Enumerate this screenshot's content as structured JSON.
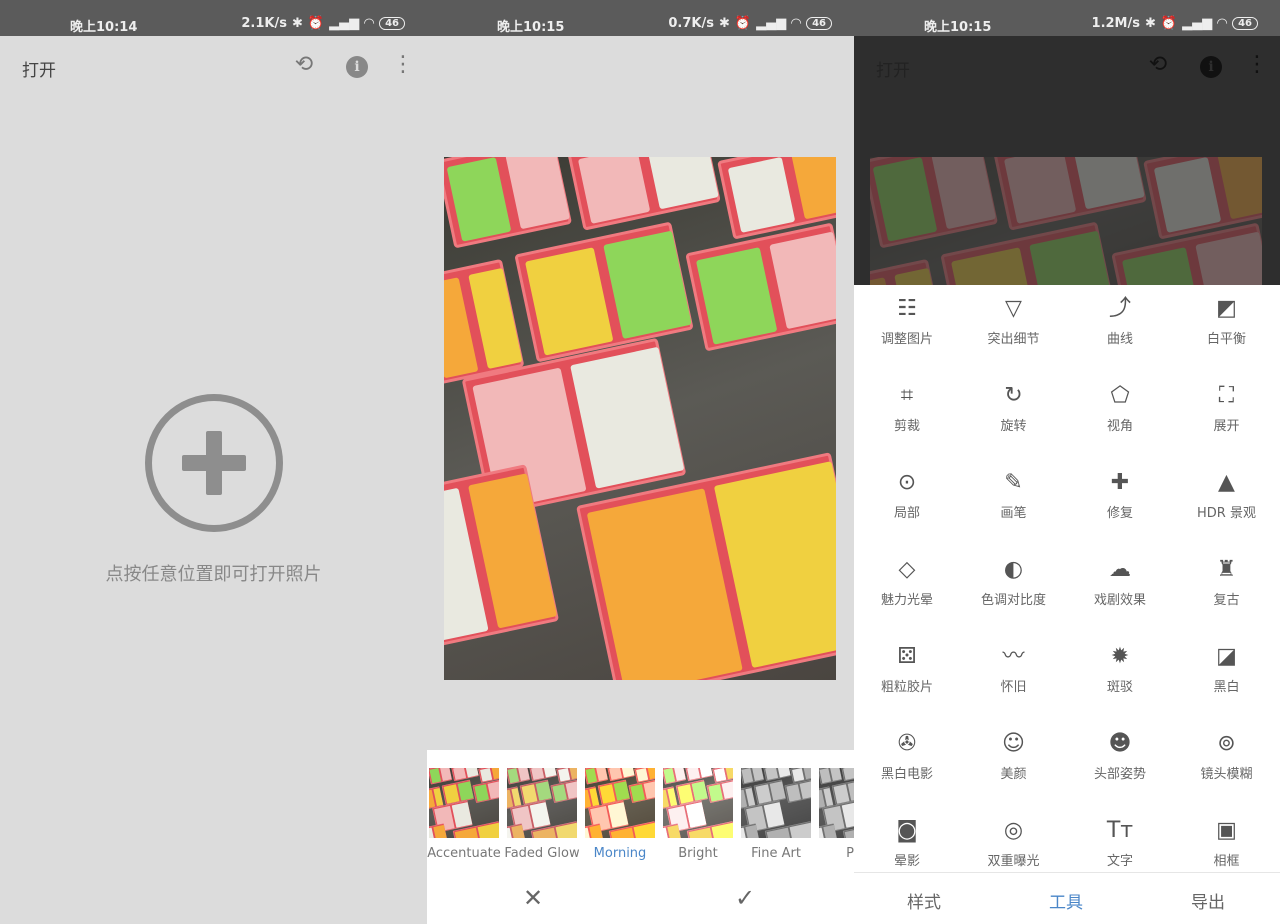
{
  "screens": [
    {
      "status": {
        "time": "晚上10:14",
        "speed": "2.1K/s",
        "battery": "46"
      },
      "appbar": {
        "title": "打开"
      },
      "hint": "点按任意位置即可打开照片"
    },
    {
      "status": {
        "time": "晚上10:15",
        "speed": "0.7K/s",
        "battery": "46"
      },
      "filters": [
        {
          "label": "Accentuate",
          "tint": "none"
        },
        {
          "label": "Faded Glow",
          "tint": "faded"
        },
        {
          "label": "Morning",
          "tint": "warm",
          "selected": true
        },
        {
          "label": "Bright",
          "tint": "bright"
        },
        {
          "label": "Fine Art",
          "tint": "bw"
        },
        {
          "label": "Pu",
          "tint": "bw"
        }
      ],
      "cancel": "✕",
      "apply": "✓"
    },
    {
      "status": {
        "time": "晚上10:15",
        "speed": "1.2M/s",
        "battery": "46"
      },
      "appbar": {
        "title": "打开"
      },
      "tools": [
        {
          "label": "调整图片",
          "icon": "tune-icon",
          "glyph": "☷"
        },
        {
          "label": "突出细节",
          "icon": "details-triangle-icon",
          "glyph": "▽"
        },
        {
          "label": "曲线",
          "icon": "curves-icon",
          "glyph": "⤴"
        },
        {
          "label": "白平衡",
          "icon": "white-balance-icon",
          "glyph": "◩"
        },
        {
          "label": "剪裁",
          "icon": "crop-icon",
          "glyph": "⌗"
        },
        {
          "label": "旋转",
          "icon": "rotate-icon",
          "glyph": "↻"
        },
        {
          "label": "视角",
          "icon": "perspective-icon",
          "glyph": "⬠"
        },
        {
          "label": "展开",
          "icon": "expand-icon",
          "glyph": "⛶"
        },
        {
          "label": "局部",
          "icon": "selective-icon",
          "glyph": "⊙"
        },
        {
          "label": "画笔",
          "icon": "brush-icon",
          "glyph": "✎"
        },
        {
          "label": "修复",
          "icon": "healing-icon",
          "glyph": "✚"
        },
        {
          "label": "HDR 景观",
          "icon": "hdr-mountain-icon",
          "glyph": "▲"
        },
        {
          "label": "魅力光晕",
          "icon": "glamour-glow-icon",
          "glyph": "◇"
        },
        {
          "label": "色调对比度",
          "icon": "tonal-contrast-icon",
          "glyph": "◐"
        },
        {
          "label": "戏剧效果",
          "icon": "drama-cloud-icon",
          "glyph": "☁"
        },
        {
          "label": "复古",
          "icon": "vintage-lamp-icon",
          "glyph": "♜"
        },
        {
          "label": "粗粒胶片",
          "icon": "grainy-film-icon",
          "glyph": "⚄"
        },
        {
          "label": "怀旧",
          "icon": "retrolux-mustache-icon",
          "glyph": "〰"
        },
        {
          "label": "斑驳",
          "icon": "grunge-icon",
          "glyph": "✹"
        },
        {
          "label": "黑白",
          "icon": "black-white-icon",
          "glyph": "◪"
        },
        {
          "label": "黑白电影",
          "icon": "noir-film-reel-icon",
          "glyph": "✇"
        },
        {
          "label": "美颜",
          "icon": "face-icon",
          "glyph": "☺"
        },
        {
          "label": "头部姿势",
          "icon": "head-pose-icon",
          "glyph": "☻"
        },
        {
          "label": "镜头模糊",
          "icon": "lens-blur-icon",
          "glyph": "⊚"
        },
        {
          "label": "晕影",
          "icon": "vignette-icon",
          "glyph": "◙"
        },
        {
          "label": "双重曝光",
          "icon": "double-exposure-icon",
          "glyph": "◎"
        },
        {
          "label": "文字",
          "icon": "text-icon",
          "glyph": "Tт"
        },
        {
          "label": "相框",
          "icon": "frame-icon",
          "glyph": "▣"
        }
      ],
      "nav": [
        {
          "label": "样式"
        },
        {
          "label": "工具",
          "active": true
        },
        {
          "label": "导出"
        }
      ]
    }
  ],
  "colors": {
    "accent": "#4a86c8",
    "panel_bg": "#dcdcdc",
    "overlay": "#2e2e2e"
  }
}
